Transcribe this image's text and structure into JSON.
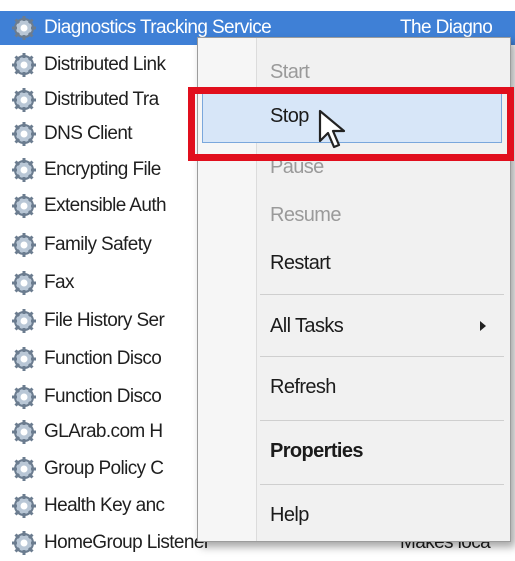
{
  "services": [
    {
      "name": "Diagnostics Tracking Service",
      "desc": "The Diagno",
      "selected": true
    },
    {
      "name": "Distributed Link",
      "desc": "",
      "selected": false
    },
    {
      "name": "Distributed Tra",
      "desc": "",
      "selected": false
    },
    {
      "name": "DNS Client",
      "desc": "",
      "selected": false
    },
    {
      "name": "Encrypting File",
      "desc": "",
      "selected": false
    },
    {
      "name": "Extensible Auth",
      "desc": "",
      "selected": false
    },
    {
      "name": "Family Safety",
      "desc": "",
      "selected": false
    },
    {
      "name": "Fax",
      "desc": "",
      "selected": false
    },
    {
      "name": "File History Ser",
      "desc": "",
      "selected": false
    },
    {
      "name": "Function Disco",
      "desc": "",
      "selected": false
    },
    {
      "name": "Function Disco",
      "desc": "",
      "selected": false
    },
    {
      "name": "GLArab.com H",
      "desc": "",
      "selected": false
    },
    {
      "name": "Group Policy C",
      "desc": "",
      "selected": false
    },
    {
      "name": "Health Key anc",
      "desc": "",
      "selected": false
    },
    {
      "name": "HomeGroup Listener",
      "desc": "Makes loca",
      "selected": false
    }
  ],
  "context_menu": {
    "start": "Start",
    "stop": "Stop",
    "pause": "Pause",
    "resume": "Resume",
    "restart": "Restart",
    "all_tasks": "All Tasks",
    "refresh": "Refresh",
    "properties": "Properties",
    "help": "Help"
  },
  "icons": {
    "service": "gear-icon",
    "submenu": "chevron-right-icon",
    "pointer": "cursor-icon"
  },
  "colors": {
    "selection": "#3f80d6",
    "highlight_box": "#e10f1d",
    "menu_hover": "#d7e6f8"
  }
}
